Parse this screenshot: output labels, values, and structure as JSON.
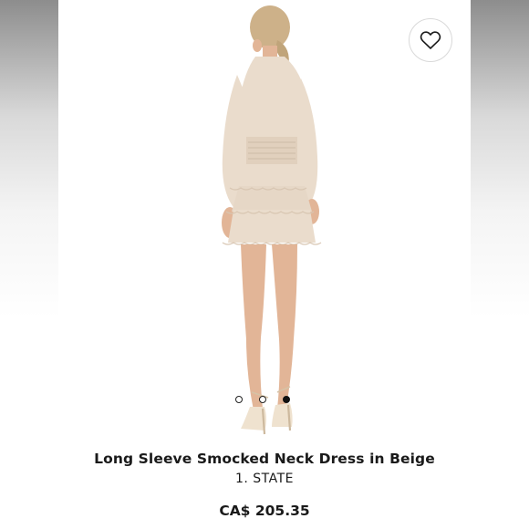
{
  "product": {
    "title": "Long Sleeve Smocked Neck Dress in Beige",
    "brand": "1. STATE",
    "price": "CA$ 205.35",
    "image": {
      "dot_count": 3,
      "active_dot": 2
    },
    "favorite_icon": "heart-outline-icon"
  },
  "colors": {
    "dress": "#eadccc",
    "skin": "#e2b597",
    "hair": "#cdb189",
    "dot_active": "#111111"
  }
}
